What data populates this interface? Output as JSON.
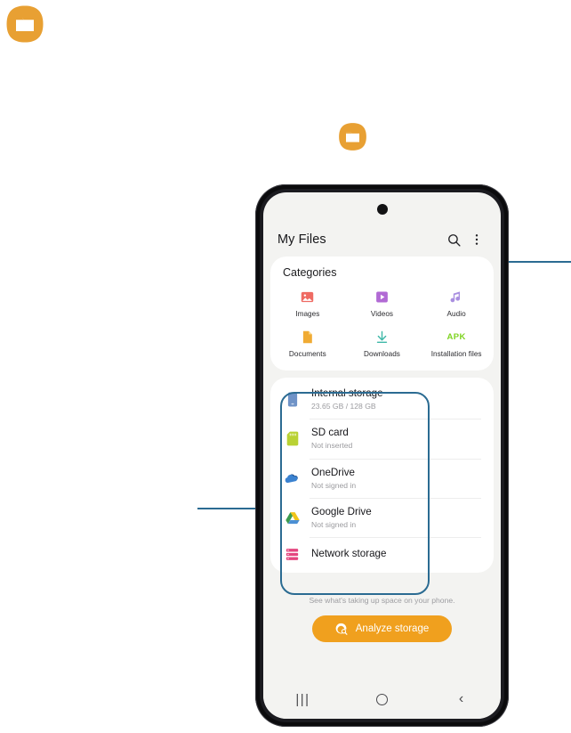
{
  "page": {
    "decorative_icons": [
      {
        "name": "folder-icon-large",
        "color": "#e8a033"
      },
      {
        "name": "folder-icon-small",
        "color": "#e8a033"
      }
    ]
  },
  "callouts": [
    {
      "name": "callout-to-search-icon",
      "target": "search-icon",
      "color": "#2b6b92"
    },
    {
      "name": "callout-to-storage-list",
      "target": "storage-list",
      "color": "#2b6b92"
    }
  ],
  "phone": {
    "app_bar": {
      "title": "My Files",
      "search_icon": "search-icon",
      "more_options_icon": "more-options-icon"
    },
    "categories": {
      "heading": "Categories",
      "items": [
        {
          "label": "Images",
          "icon": "image-icon",
          "color": "#ef6b63"
        },
        {
          "label": "Videos",
          "icon": "video-play-icon",
          "color": "#b16ad4"
        },
        {
          "label": "Audio",
          "icon": "music-note-icon",
          "color": "#a98fe0"
        },
        {
          "label": "Documents",
          "icon": "document-icon",
          "color": "#f0ab33"
        },
        {
          "label": "Downloads",
          "icon": "download-arrow-icon",
          "color": "#3fb8a8"
        },
        {
          "label": "Installation files",
          "icon": "apk-icon",
          "glyph": "APK",
          "color": "#7ed321"
        }
      ]
    },
    "storage": {
      "items": [
        {
          "title": "Internal storage",
          "subtitle": "23.65 GB / 128 GB",
          "icon": "phone-storage-icon",
          "color": "#6f93c7"
        },
        {
          "title": "SD card",
          "subtitle": "Not inserted",
          "icon": "sd-card-icon",
          "color": "#b9d234"
        },
        {
          "title": "OneDrive",
          "subtitle": "Not signed in",
          "icon": "onedrive-icon",
          "color": "#2a6ab5"
        },
        {
          "title": "Google Drive",
          "subtitle": "Not signed in",
          "icon": "google-drive-icon",
          "color": "#f0c419"
        },
        {
          "title": "Network storage",
          "subtitle": "",
          "icon": "network-storage-icon",
          "color": "#e4467f"
        }
      ]
    },
    "analyze": {
      "hint": "See what's taking up space on your phone.",
      "button_label": "Analyze storage",
      "button_icon": "analyze-storage-icon",
      "button_color": "#f0a01e"
    },
    "nav_bar": {
      "recents_label": "|||",
      "recents_icon": "recents-icon",
      "home_icon": "home-icon",
      "back_label": "‹",
      "back_icon": "back-icon"
    }
  }
}
